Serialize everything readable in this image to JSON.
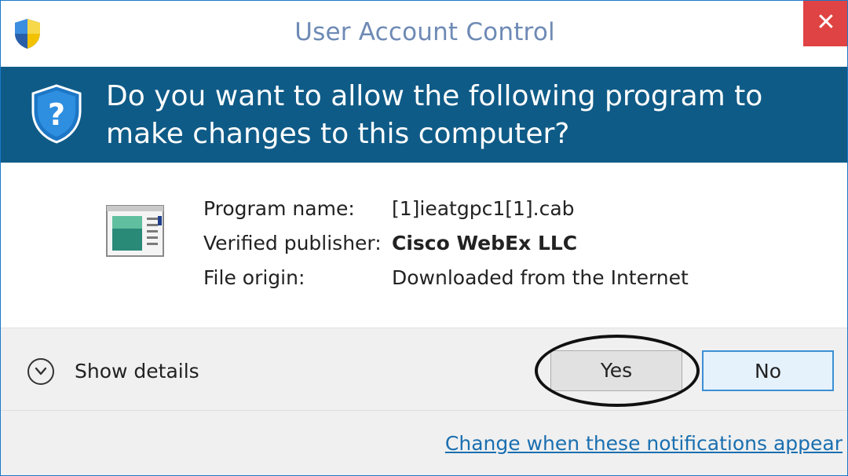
{
  "window": {
    "title": "User Account Control",
    "close_glyph": "✕"
  },
  "banner": {
    "question": "Do you want to allow the following program to make changes to this computer?"
  },
  "program": {
    "name_label": "Program name:",
    "name_value": "[1]ieatgpc1[1].cab",
    "publisher_label": "Verified publisher:",
    "publisher_value": "Cisco WebEx LLC",
    "origin_label": "File origin:",
    "origin_value": "Downloaded from the Internet"
  },
  "footer": {
    "show_details": "Show details",
    "yes_label": "Yes",
    "no_label": "No",
    "notifications_link": "Change when these notifications appear"
  },
  "icons": {
    "title": "uac-shield-icon",
    "banner": "shield-question-icon",
    "program": "program-window-icon",
    "details": "chevron-down-circle-icon"
  },
  "colors": {
    "banner": "#0f5b87",
    "title_text": "#6e8ab5",
    "close": "#e04343",
    "link": "#1a6fb0"
  }
}
